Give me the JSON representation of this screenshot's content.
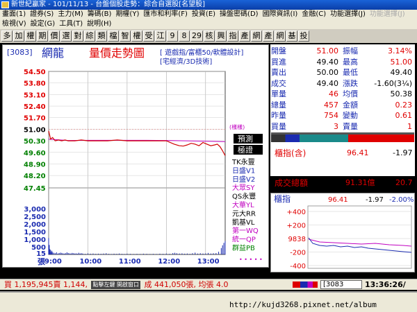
{
  "window": {
    "title": "新世紀贏家 - 101/11/13 - 台盤個股走勢：綜合自選股[名望股]"
  },
  "menu": {
    "row1": [
      {
        "label": "畫面(1)",
        "enabled": true
      },
      {
        "label": "證券(S)",
        "enabled": true
      },
      {
        "label": "主力(M)",
        "enabled": true
      },
      {
        "label": "籌碼(B)",
        "enabled": true
      },
      {
        "label": "期權(Y)",
        "enabled": true
      },
      {
        "label": "匯市和利率(F)",
        "enabled": true
      },
      {
        "label": "投資(E)",
        "enabled": true
      },
      {
        "label": "操盤密碼(D)",
        "enabled": true
      },
      {
        "label": "國際資訊(I)",
        "enabled": true
      },
      {
        "label": "金融(C)",
        "enabled": true
      },
      {
        "label": "功能選擇(J)",
        "enabled": true
      },
      {
        "label": "功能選擇(J)",
        "enabled": false
      }
    ],
    "row2": [
      {
        "label": "檢視(V)",
        "enabled": true
      },
      {
        "label": "設定(G)",
        "enabled": true
      },
      {
        "label": "工具(T)",
        "enabled": true
      },
      {
        "label": "說明(H)",
        "enabled": true
      }
    ]
  },
  "toolbar": {
    "buttons": [
      "多",
      "加",
      "權",
      "期",
      "價",
      "選",
      "對",
      "綜",
      "類",
      "檔",
      "智",
      "權",
      "受",
      "江",
      "9",
      "8",
      "29",
      "核",
      "興",
      "指",
      "產",
      "網",
      "產",
      "網",
      "基",
      "投"
    ]
  },
  "stock": {
    "code": "[3083]",
    "name": "網龍",
    "chart_title": "量價走勢圖",
    "links1": "[ 遊戲指/富櫃50/軟體設計]",
    "links2": "[宅經濟/3D技術]"
  },
  "sidebar": {
    "small": "(樣樣)",
    "tabs": [
      "預測",
      "極證"
    ],
    "brokers": [
      {
        "name": "TK永豐",
        "color": "#000000"
      },
      {
        "name": "日盛V1",
        "color": "#1a2bb0"
      },
      {
        "name": "日盛V2",
        "color": "#1a2bb0"
      },
      {
        "name": "大眾SY",
        "color": "#c000c0"
      },
      {
        "name": "QS永豐",
        "color": "#000000"
      },
      {
        "name": "大華YL",
        "color": "#c000c0"
      },
      {
        "name": "元大RR",
        "color": "#000000"
      },
      {
        "name": "凱基VL",
        "color": "#000000"
      },
      {
        "name": "第一WQ",
        "color": "#c000c0"
      },
      {
        "name": "統一QP",
        "color": "#c000c0"
      },
      {
        "name": "群益PB",
        "color": "#008000"
      }
    ],
    "dots": "• • • • •"
  },
  "chart_data": {
    "type": "line",
    "price_axis": {
      "ticks": [
        "54.50",
        "53.80",
        "53.10",
        "52.40",
        "51.70",
        "51.00",
        "50.30",
        "49.60",
        "48.90",
        "48.20",
        "47.45"
      ],
      "ylim": [
        47.45,
        54.5
      ],
      "reference": 51.0
    },
    "volume_axis": {
      "ticks": [
        "3,000",
        "2,500",
        "2,000",
        "1,500",
        "1,000",
        "500",
        "15"
      ],
      "unit": "張",
      "ylim": [
        0,
        3000
      ]
    },
    "x_ticks": [
      "9:00",
      "10:00",
      "11:00",
      "12:00",
      "13:00"
    ],
    "x_range_minutes": [
      0,
      270
    ],
    "price": {
      "color": "#d00000",
      "points": [
        [
          0,
          50.9
        ],
        [
          3,
          50.4
        ],
        [
          6,
          50.5
        ],
        [
          10,
          50.3
        ],
        [
          15,
          50.35
        ],
        [
          20,
          50.3
        ],
        [
          25,
          50.35
        ],
        [
          30,
          50.3
        ],
        [
          40,
          50.3
        ],
        [
          50,
          50.35
        ],
        [
          60,
          50.3
        ],
        [
          75,
          50.3
        ],
        [
          90,
          50.3
        ],
        [
          105,
          50.35
        ],
        [
          120,
          50.3
        ],
        [
          135,
          50.3
        ],
        [
          150,
          50.3
        ],
        [
          165,
          50.3
        ],
        [
          180,
          50.3
        ],
        [
          192,
          50.1
        ],
        [
          200,
          50.0
        ],
        [
          206,
          49.98
        ],
        [
          212,
          50.05
        ],
        [
          218,
          50.15
        ],
        [
          224,
          50.1
        ],
        [
          230,
          50.0
        ],
        [
          236,
          50.2
        ],
        [
          242,
          50.1
        ],
        [
          248,
          50.0
        ],
        [
          254,
          50.05
        ],
        [
          258,
          50.1
        ],
        [
          262,
          49.95
        ],
        [
          266,
          49.7
        ],
        [
          270,
          49.4
        ]
      ]
    },
    "avg": {
      "color": "#c000c0",
      "points": [
        [
          0,
          50.4
        ],
        [
          30,
          50.32
        ],
        [
          60,
          50.33
        ],
        [
          90,
          50.33
        ],
        [
          120,
          50.33
        ],
        [
          150,
          50.33
        ],
        [
          180,
          50.32
        ],
        [
          210,
          50.3
        ],
        [
          240,
          50.28
        ],
        [
          270,
          50.25
        ]
      ]
    },
    "volume": {
      "color": "#1a2bb0",
      "bars": [
        [
          0,
          1080
        ],
        [
          1,
          620
        ],
        [
          2,
          340
        ],
        [
          3,
          280
        ],
        [
          4,
          160
        ],
        [
          5,
          240
        ],
        [
          6,
          140
        ],
        [
          8,
          110
        ],
        [
          10,
          80
        ],
        [
          12,
          140
        ],
        [
          14,
          60
        ],
        [
          16,
          90
        ],
        [
          18,
          120
        ],
        [
          20,
          100
        ],
        [
          22,
          70
        ],
        [
          24,
          60
        ],
        [
          26,
          80
        ],
        [
          28,
          140
        ],
        [
          30,
          90
        ],
        [
          32,
          70
        ],
        [
          34,
          60
        ],
        [
          36,
          100
        ],
        [
          38,
          80
        ],
        [
          40,
          60
        ],
        [
          42,
          70
        ],
        [
          44,
          50
        ],
        [
          46,
          110
        ],
        [
          48,
          60
        ],
        [
          50,
          80
        ],
        [
          52,
          60
        ],
        [
          56,
          40
        ],
        [
          60,
          70
        ],
        [
          64,
          50
        ],
        [
          68,
          60
        ],
        [
          72,
          40
        ],
        [
          76,
          50
        ],
        [
          80,
          40
        ],
        [
          84,
          60
        ],
        [
          88,
          80
        ],
        [
          92,
          40
        ],
        [
          96,
          30
        ],
        [
          100,
          50
        ],
        [
          104,
          40
        ],
        [
          108,
          60
        ],
        [
          112,
          40
        ],
        [
          116,
          30
        ],
        [
          120,
          50
        ],
        [
          125,
          40
        ],
        [
          130,
          30
        ],
        [
          135,
          40
        ],
        [
          140,
          30
        ],
        [
          145,
          50
        ],
        [
          150,
          40
        ],
        [
          155,
          30
        ],
        [
          160,
          40
        ],
        [
          165,
          30
        ],
        [
          170,
          50
        ],
        [
          175,
          40
        ],
        [
          180,
          60
        ],
        [
          185,
          40
        ],
        [
          190,
          90
        ],
        [
          193,
          110
        ],
        [
          196,
          80
        ],
        [
          200,
          60
        ],
        [
          204,
          70
        ],
        [
          208,
          50
        ],
        [
          212,
          60
        ],
        [
          216,
          40
        ],
        [
          220,
          80
        ],
        [
          224,
          120
        ],
        [
          228,
          60
        ],
        [
          232,
          80
        ],
        [
          236,
          60
        ],
        [
          240,
          70
        ],
        [
          244,
          100
        ],
        [
          248,
          60
        ],
        [
          252,
          80
        ],
        [
          256,
          90
        ],
        [
          260,
          180
        ],
        [
          264,
          420
        ],
        [
          266,
          600
        ],
        [
          268,
          760
        ],
        [
          270,
          880
        ]
      ]
    }
  },
  "quote": {
    "rows": [
      {
        "l": "開盤",
        "v": "51.00",
        "vc": "#e00000",
        "l2": "振幅",
        "v2": "3.14%",
        "v2c": "#e00000"
      },
      {
        "l": "買進",
        "v": "49.40",
        "vc": "#000000",
        "l2": "最高",
        "v2": "51.00",
        "v2c": "#e00000"
      },
      {
        "l": "賣出",
        "v": "50.00",
        "vc": "#000000",
        "l2": "最低",
        "v2": "49.40",
        "v2c": "#000000"
      },
      {
        "l": "成交",
        "v": "49.40",
        "vc": "#000000",
        "l2": "漲跌",
        "v2": "-1.60(3¼)",
        "v2c": "#000000"
      },
      {
        "l": "單量",
        "v": "46",
        "vc": "#e00000",
        "l2": "均價",
        "v2": "50.38",
        "v2c": "#000000"
      },
      {
        "l": "總量",
        "v": "457",
        "vc": "#e00000",
        "l2": "金額",
        "v2": "0.23",
        "v2c": "#e00000"
      },
      {
        "l": "昨量",
        "v": "754",
        "vc": "#e00000",
        "l2": "變動",
        "v2": "0.61",
        "v2c": "#e00000"
      },
      {
        "l": "買量",
        "v": "3",
        "vc": "#e00000",
        "l2": "賣量",
        "v2": "1",
        "v2c": "#e00000"
      }
    ]
  },
  "index_box": {
    "label": "櫃指(含)",
    "value": "96.41",
    "change": "-1.97",
    "total_label": "成交總額",
    "total_value": "91.31億",
    "total_change": "20.7"
  },
  "mini_chart": {
    "label": "櫃指",
    "value": "96.41",
    "change": "-1.97",
    "pct": "-2.00%",
    "ticks": [
      "+400",
      "+200",
      "9838",
      "-200",
      "-400"
    ]
  },
  "status": {
    "text": "買 1,195,945賣 1,144,",
    "text2": "成 441,050張, 均張 4.0",
    "code_box": "[3083",
    "clock": "13:36:26/",
    "tip": "點擊左鍵 開啟窗口"
  },
  "watermark": "http://kujd3268.pixnet.net/album"
}
